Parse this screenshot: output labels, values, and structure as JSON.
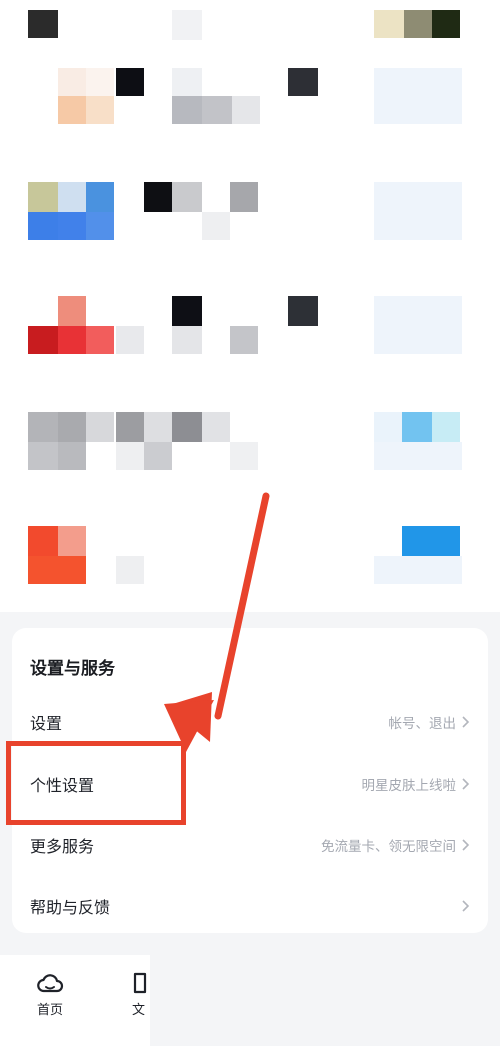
{
  "section": {
    "title": "设置与服务"
  },
  "rows": [
    {
      "label": "设置",
      "hint": "帐号、退出"
    },
    {
      "label": "个性设置",
      "hint": "明星皮肤上线啦"
    },
    {
      "label": "更多服务",
      "hint": "免流量卡、领无限空间"
    },
    {
      "label": "帮助与反馈",
      "hint": ""
    }
  ],
  "nav": [
    {
      "label": "首页",
      "icon": "cloud-icon"
    },
    {
      "label": "文",
      "icon": "file-icon"
    }
  ],
  "colors": {
    "accent": "#e8432c",
    "hint": "#a4a8b1"
  }
}
